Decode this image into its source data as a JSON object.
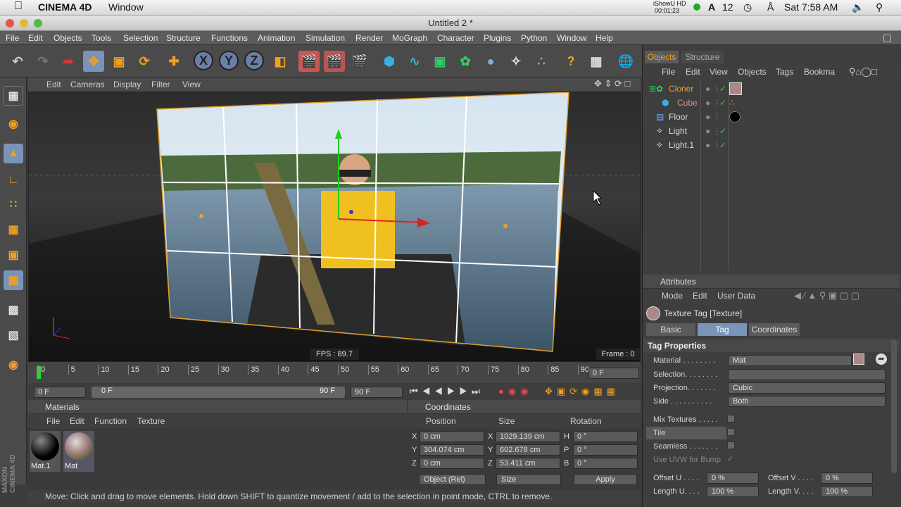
{
  "mac": {
    "app": "CINEMA 4D",
    "window": "Window",
    "rec_top": "iShowU HD",
    "rec_time": "00:01:23",
    "input": "A",
    "date": "12",
    "clock": "Sat 7:58 AM"
  },
  "window_title": "Untitled 2 *",
  "menu": [
    "File",
    "Edit",
    "Objects",
    "Tools",
    "Selection",
    "Structure",
    "Functions",
    "Animation",
    "Simulation",
    "Render",
    "MoGraph",
    "Character",
    "Plugins",
    "Python",
    "Window",
    "Help"
  ],
  "toolbar": {
    "axis_x": "X",
    "axis_y": "Y",
    "axis_z": "Z"
  },
  "viewport": {
    "menu": [
      "Edit",
      "Cameras",
      "Display",
      "Filter",
      "View"
    ],
    "fps": "FPS : 89.7",
    "frame": "Frame : 0"
  },
  "timeline": {
    "ticks": [
      "0",
      "5",
      "10",
      "15",
      "20",
      "25",
      "30",
      "35",
      "40",
      "45",
      "50",
      "55",
      "60",
      "65",
      "70",
      "75",
      "80",
      "85",
      "90"
    ],
    "current": "0 F"
  },
  "transport": {
    "start": "0 F",
    "range_start": "0 F",
    "range_end": "90 F",
    "end": "90 F"
  },
  "materials": {
    "title": "Materials",
    "menu": [
      "File",
      "Edit",
      "Function",
      "Texture"
    ],
    "items": [
      "Mat.1",
      "Mat"
    ]
  },
  "coordinates": {
    "title": "Coordinates",
    "headers": [
      "Position",
      "Size",
      "Rotation"
    ],
    "rows": [
      {
        "axis": "X",
        "pos": "0 cm",
        "saxis": "X",
        "size": "1029.139 cm",
        "raxis": "H",
        "rot": "0 °"
      },
      {
        "axis": "Y",
        "pos": "304.074 cm",
        "saxis": "Y",
        "size": "602.678 cm",
        "raxis": "P",
        "rot": "0 °"
      },
      {
        "axis": "Z",
        "pos": "0 cm",
        "saxis": "Z",
        "size": "53.411 cm",
        "raxis": "B",
        "rot": "0 °"
      }
    ],
    "mode": "Object (Rel)",
    "size_mode": "Size",
    "apply": "Apply"
  },
  "status": "Move: Click and drag to move elements. Hold down SHIFT to quantize movement / add to the selection in point mode, CTRL to remove.",
  "objects_panel": {
    "tabs": [
      "Objects",
      "Structure"
    ],
    "menu": [
      "File",
      "Edit",
      "View",
      "Objects",
      "Tags",
      "Bookma"
    ],
    "items": [
      "Cloner",
      "Cube",
      "Floor",
      "Light",
      "Light.1"
    ]
  },
  "attributes": {
    "title": "Attributes",
    "menu": [
      "Mode",
      "Edit",
      "User Data"
    ],
    "tag_title": "Texture Tag [Texture]",
    "tabs": [
      "Basic",
      "Tag",
      "Coordinates"
    ],
    "section": "Tag Properties",
    "material_label": "Material . . . . . . . .",
    "material": "Mat",
    "selection_label": "Selection. . . . . . . .",
    "projection_label": "Projection. . . . . . .",
    "projection": "Cubic",
    "side_label": "Side . . . . . . . . . .",
    "side": "Both",
    "mix_label": "Mix Textures . . . . .",
    "tile_label": "Tile",
    "seamless_label": "Seamless . . . . . . .",
    "uvw_label": "Use UVW for Bump",
    "offset_u_label": "Offset U . . . .",
    "offset_u": "0 %",
    "offset_v_label": "Offset V . . . .",
    "offset_v": "0 %",
    "length_u_label": "Length U. . . .",
    "length_u": "100 %",
    "length_v_label": "Length V. . . .",
    "length_v": "100 %"
  },
  "brand": "MAXON CINEMA 4D"
}
